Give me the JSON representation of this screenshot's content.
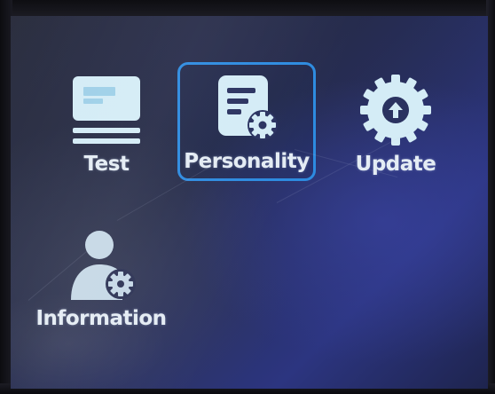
{
  "menu": {
    "items": [
      {
        "id": "test",
        "label": "Test",
        "icon": "card-reader-icon",
        "selected": false
      },
      {
        "id": "personality",
        "label": "Personality",
        "icon": "document-settings-icon",
        "selected": true
      },
      {
        "id": "update",
        "label": "Update",
        "icon": "upload-arrow-icon",
        "selected": false
      },
      {
        "id": "information",
        "label": "Information",
        "icon": "user-settings-icon",
        "selected": false
      }
    ]
  },
  "colors": {
    "icon": "#d4ecf6",
    "label": "#e4ecf4",
    "selection_border": "#2d8be0",
    "screen_background": "#262c58"
  }
}
